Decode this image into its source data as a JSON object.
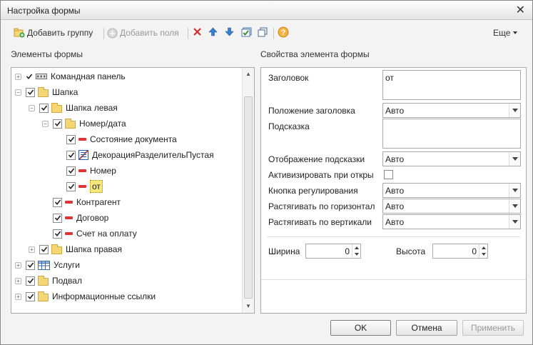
{
  "window": {
    "title": "Настройка формы"
  },
  "toolbar": {
    "add_group": "Добавить группу",
    "add_fields": "Добавить поля",
    "more": "Еще"
  },
  "left_panel": {
    "title": "Элементы формы"
  },
  "right_panel": {
    "title": "Свойства элемента формы"
  },
  "tree": [
    {
      "label": "Командная панель",
      "checked": true,
      "icon": "command-bar-icon",
      "expander": "plus"
    },
    {
      "label": "Шапка",
      "checked": true,
      "icon": "folder-icon",
      "expander": "minus"
    },
    {
      "label": "Шапка левая",
      "checked": true,
      "icon": "folder-icon",
      "expander": "minus"
    },
    {
      "label": "Номер/дата",
      "checked": true,
      "icon": "folder-icon",
      "expander": "minus"
    },
    {
      "label": "Состояние документа",
      "checked": true,
      "icon": "field-icon",
      "expander": "none"
    },
    {
      "label": "ДекорацияРазделительПустая",
      "checked": true,
      "icon": "decoration-icon",
      "expander": "none"
    },
    {
      "label": "Номер",
      "checked": true,
      "icon": "field-icon",
      "expander": "none"
    },
    {
      "label": "от",
      "checked": true,
      "icon": "field-icon",
      "expander": "none",
      "selected": true
    },
    {
      "label": "Контрагент",
      "checked": true,
      "icon": "field-icon",
      "expander": "none"
    },
    {
      "label": "Договор",
      "checked": true,
      "icon": "field-icon",
      "expander": "none"
    },
    {
      "label": "Счет на оплату",
      "checked": true,
      "icon": "field-icon",
      "expander": "none"
    },
    {
      "label": "Шапка правая",
      "checked": true,
      "icon": "folder-icon",
      "expander": "plus"
    },
    {
      "label": "Услуги",
      "checked": true,
      "icon": "table-icon",
      "expander": "plus"
    },
    {
      "label": "Подвал",
      "checked": true,
      "icon": "folder-icon",
      "expander": "plus"
    },
    {
      "label": "Информационные ссылки",
      "checked": true,
      "icon": "folder-icon",
      "expander": "plus"
    }
  ],
  "props": {
    "caption_label": "Заголовок",
    "caption_value": "от",
    "caption_position_label": "Положение заголовка",
    "caption_position_value": "Авто",
    "tooltip_label": "Подсказка",
    "tooltip_value": "",
    "tooltip_display_label": "Отображение подсказки",
    "tooltip_display_value": "Авто",
    "activate_label": "Активизировать при откры",
    "activate_checked": false,
    "adjust_button_label": "Кнопка регулирования",
    "adjust_button_value": "Авто",
    "stretch_h_label": "Растягивать по горизонтал",
    "stretch_h_value": "Авто",
    "stretch_v_label": "Растягивать по вертикали",
    "stretch_v_value": "Авто",
    "width_label": "Ширина",
    "width_value": "0",
    "height_label": "Высота",
    "height_value": "0"
  },
  "buttons": {
    "ok": "OK",
    "cancel": "Отмена",
    "apply": "Применить"
  },
  "colors": {
    "selection": "#f8e77a",
    "field_marker": "#e23333",
    "folder": "#f4d774"
  }
}
